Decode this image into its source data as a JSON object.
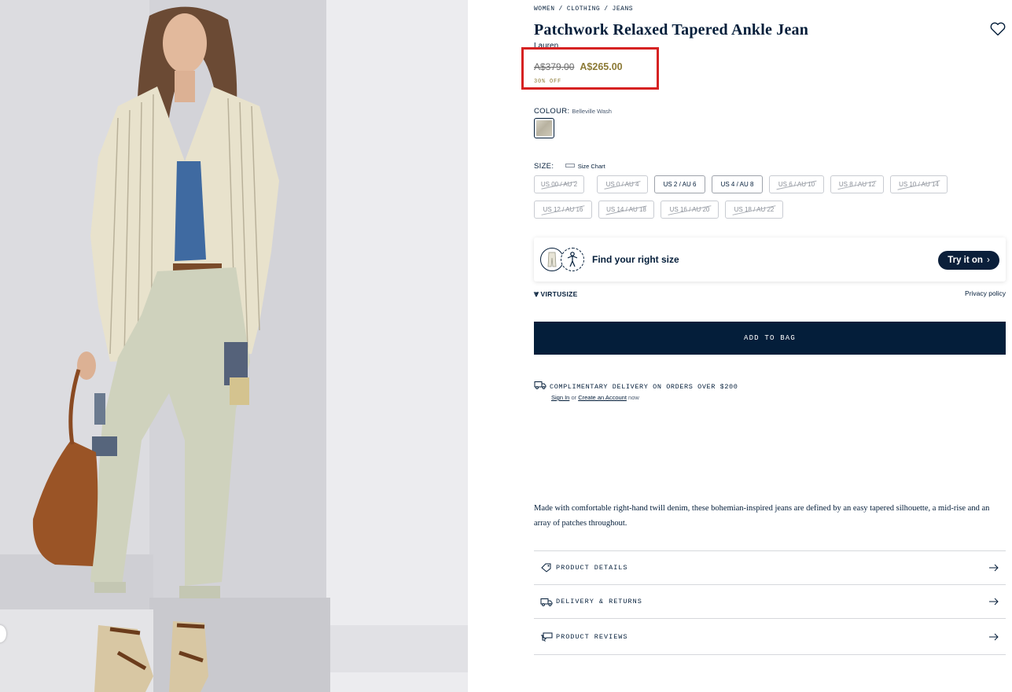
{
  "breadcrumb": [
    "WOMEN",
    "CLOTHING",
    "JEANS"
  ],
  "product": {
    "title": "Patchwork Relaxed Tapered Ankle Jean",
    "brand": "Lauren",
    "price_original": "A$379.00",
    "price_sale": "A$265.00",
    "discount": "30% OFF"
  },
  "colour": {
    "label": "COLOUR:",
    "value": "Belleville Wash"
  },
  "size": {
    "label": "SIZE:",
    "chart_label": "Size Chart",
    "options": [
      {
        "label": "US 00 / AU 2",
        "available": false
      },
      {
        "label": "US 0 / AU 4",
        "available": false
      },
      {
        "label": "US 2 / AU 6",
        "available": true
      },
      {
        "label": "US 4 / AU 8",
        "available": true
      },
      {
        "label": "US 6 / AU 10",
        "available": false
      },
      {
        "label": "US 8 / AU 12",
        "available": false
      },
      {
        "label": "US 10 / AU 14",
        "available": false
      },
      {
        "label": "US 12 / AU 16",
        "available": false
      },
      {
        "label": "US 14 / AU 18",
        "available": false
      },
      {
        "label": "US 16 / AU 20",
        "available": false
      },
      {
        "label": "US 18 / AU 22",
        "available": false
      }
    ]
  },
  "virtusize": {
    "prompt": "Find your right size",
    "button": "Try it on",
    "brand": "VIRTUSIZE",
    "privacy": "Privacy policy"
  },
  "add_to_bag": "ADD TO BAG",
  "delivery": {
    "text": "COMPLIMENTARY DELIVERY ON ORDERS OVER $200",
    "sign_in": "Sign In",
    "or": "or",
    "create_account": "Create an Account",
    "now": "now"
  },
  "description": "Made with comfortable right-hand twill denim, these bohemian-inspired jeans are defined by an easy tapered silhouette, a mid-rise and an array of patches throughout.",
  "accordion": [
    {
      "label": "PRODUCT DETAILS",
      "icon": "tag-icon"
    },
    {
      "label": "DELIVERY & RETURNS",
      "icon": "truck-icon"
    },
    {
      "label": "PRODUCT REVIEWS",
      "icon": "reviews-icon"
    }
  ],
  "colors": {
    "navy": "#041e3a",
    "sale_gold": "#8c7a36",
    "highlight_red": "#d62222"
  }
}
